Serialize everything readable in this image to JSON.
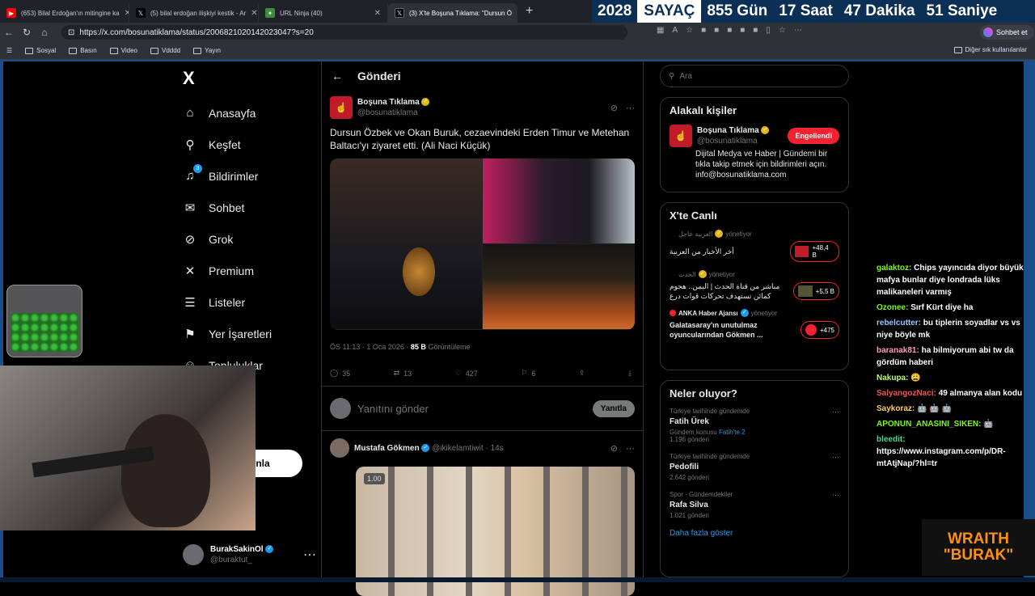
{
  "browser": {
    "tabs": [
      {
        "label": "(653) Bilal Erdoğan'ın mitingine ka",
        "color": "#ff0000",
        "glyph": "▶"
      },
      {
        "label": "(5) bilal erdoğan ilişkiyi kestik - Ar",
        "color": "#000000",
        "glyph": "𝕏"
      },
      {
        "label": "URL Ninja (40)",
        "color": "#3c8c3c",
        "glyph": "🥷"
      },
      {
        "label": "(3) X'te Boşuna Tıklama: \"Dursun Ö",
        "color": "#000000",
        "glyph": "𝕏"
      }
    ],
    "new_tab": "+",
    "url": "https://x.com/bosunatiklama/status/2006821020142023047?s=20",
    "chat_button": "Sohbet et",
    "bookmarks": [
      "Sosyal",
      "Basın",
      "Video",
      "Vdddd",
      "Yayın"
    ],
    "bookmarks_other": "Diğer sık kullanılanlar"
  },
  "countdown": {
    "year": "2028",
    "label": "SAYAÇ",
    "days": "855 Gün",
    "hours": "17 Saat",
    "minutes": "47 Dakika",
    "seconds": "51 Saniye"
  },
  "sidebar": {
    "logo": "X",
    "items": [
      {
        "label": "Anasayfa",
        "icon": "home-icon"
      },
      {
        "label": "Keşfet",
        "icon": "search-icon"
      },
      {
        "label": "Bildirimler",
        "icon": "bell-icon",
        "badge": "3"
      },
      {
        "label": "Sohbet",
        "icon": "mail-icon"
      },
      {
        "label": "Grok",
        "icon": "grok-icon"
      },
      {
        "label": "Premium",
        "icon": "x-icon"
      },
      {
        "label": "Listeler",
        "icon": "list-icon"
      },
      {
        "label": "Yer İşaretleri",
        "icon": "bookmark-icon"
      },
      {
        "label": "Topluluklar",
        "icon": "people-icon"
      }
    ],
    "post_button": "ıynla",
    "account": {
      "name": "BurakSakinOl",
      "handle": "@buraktut_"
    }
  },
  "main": {
    "header": "Gönderi",
    "post": {
      "author": "Boşuna Tıklama",
      "handle": "@bosunatiklama",
      "text": "Dursun Özbek ve Okan Buruk, cezaevindeki Erden Timur ve Metehan Baltacı'yı ziyaret etti. (Ali Naci Küçük)",
      "time": "ÖS 11:13 · 1 Oca 2026 ·",
      "views": "85 B",
      "views_label": "Görüntüleme",
      "replies": "35",
      "reposts": "13",
      "likes": "427",
      "bookmarks": "6"
    },
    "reply_placeholder": "Yanıtını gönder",
    "reply_button": "Yanıtla",
    "post2": {
      "author": "Mustafa Gökmen",
      "handle": "@ikikelamtiwit",
      "time": "· 14s",
      "media_badge": "1.00"
    }
  },
  "right": {
    "search_placeholder": "Ara",
    "related_title": "Alakalı kişiler",
    "related": {
      "name": "Boşuna Tıklama",
      "handle": "@bosunatiklama",
      "button": "Engellendi",
      "bio": "Dijital Medya ve Haber | Gündemi bir tıkla takip etmek için bildirimleri açın. info@bosunatiklama.com"
    },
    "live_title": "X'te Canlı",
    "live": [
      {
        "source": "العربية عاجل",
        "status": "yönetiyor",
        "title": "أخر الأخبار من العربية",
        "count": "+48,4 B"
      },
      {
        "source": "الحدث",
        "status": "yönetiyor",
        "title": "مباشر من قناة الحدث | اليمن.. هجوم كمائن تستهدف تحركات قوات درع",
        "count": "+5,5 B"
      },
      {
        "source": "ANKA Haber Ajansı",
        "status": "yönetiyor",
        "title": "Galatasaray'ın unutulmaz oyuncularından Gökmen ...",
        "count": "+475"
      }
    ],
    "trends_title": "Neler oluyor?",
    "trends": [
      {
        "context": "Türkiye tarihinde gündemde",
        "name": "Fatih Ürek",
        "extra": "Gündem konusu",
        "extra_link": "Fatih'te 2",
        "count": "1.196 gönderi"
      },
      {
        "context": "Türkiye tarihinde gündemde",
        "name": "Pedofili",
        "extra": "",
        "extra_link": "",
        "count": "2.642 gönderi"
      },
      {
        "context": "Spor · Gündemdekiler",
        "name": "Rafa Silva",
        "extra": "",
        "extra_link": "",
        "count": "1.021 gönderi"
      }
    ],
    "more": "Daha fazla göster"
  },
  "chat": [
    {
      "user": "galaktoz:",
      "text": "Chips yayıncıda diyor büyük mafya bunlar diye londrada lüks malikaneleri varmış"
    },
    {
      "user": "Ozonee:",
      "text": "Sırf Kürt diye ha"
    },
    {
      "user": "rebelcutter:",
      "text": "bu tiplerin soyadlar vs vs niye böyle mk"
    },
    {
      "user": "baranak81:",
      "text": "ha bilmiyorum abi tw da gördüm haberi"
    },
    {
      "user": "Nakupa:",
      "text": "😩"
    },
    {
      "user": "SalyangozNaci:",
      "text": "49 almanya alan kodu"
    },
    {
      "user": "Saykoraz:",
      "text": "🤖 🤖 🤖"
    },
    {
      "user": "APONUN_ANASINI_SIKEN:",
      "text": "🤖"
    },
    {
      "user": "bleedit:",
      "text": "https://www.instagram.com/p/DR-mtAtjNap/?hl=tr"
    }
  ],
  "overlay": {
    "brand_top": "WRAITH",
    "brand_bottom": "\"BURAK\""
  }
}
